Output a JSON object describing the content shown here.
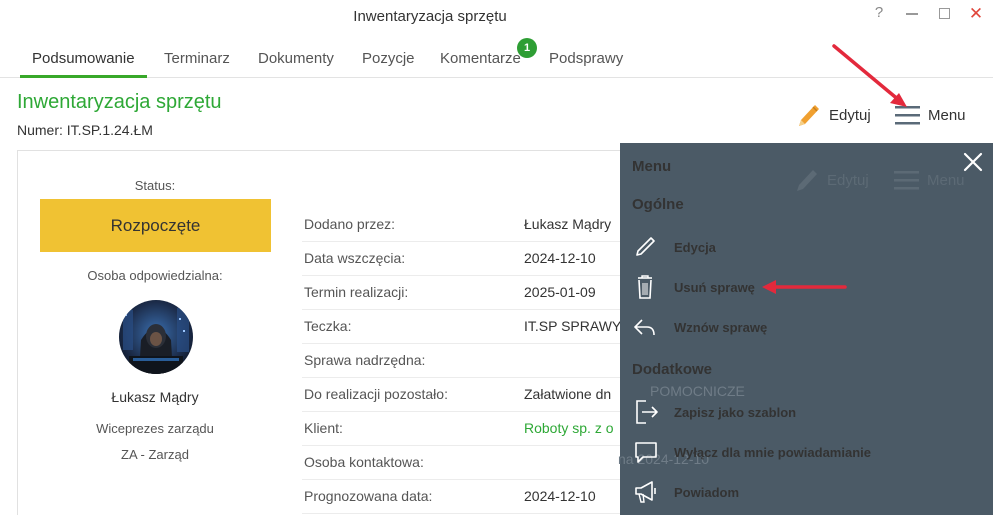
{
  "window": {
    "title": "Inwentaryzacja sprzętu",
    "help": "?",
    "close": "✕"
  },
  "tabs": [
    {
      "label": "Podsumowanie",
      "active": true
    },
    {
      "label": "Terminarz"
    },
    {
      "label": "Dokumenty"
    },
    {
      "label": "Pozycje"
    },
    {
      "label": "Komentarze",
      "badge": "1"
    },
    {
      "label": "Podsprawy"
    }
  ],
  "header": {
    "title": "Inwentaryzacja sprzętu",
    "number": "Numer: IT.SP.1.24.ŁM",
    "edit_label": "Edytuj",
    "menu_label": "Menu"
  },
  "status": {
    "label": "Status:",
    "value": "Rozpoczęte",
    "color": "#f0c233"
  },
  "responsible": {
    "label": "Osoba odpowiedzialna:",
    "name": "Łukasz Mądry",
    "role": "Wiceprezes zarządu",
    "department": "ZA - Zarząd"
  },
  "details": [
    {
      "key": "Dodano przez:",
      "value": "Łukasz Mądry"
    },
    {
      "key": "Data wszczęcia:",
      "value": "2024-12-10"
    },
    {
      "key": "Termin realizacji:",
      "value": "2025-01-09"
    },
    {
      "key": "Teczka:",
      "value": "IT.SP SPRAWY"
    },
    {
      "key": "Sprawa nadrzędna:",
      "value": ""
    },
    {
      "key": "Do realizacji pozostało:",
      "value": "Załatwione dn"
    },
    {
      "key": "Klient:",
      "value": "Roboty sp. z o"
    },
    {
      "key": "Osoba kontaktowa:",
      "value": ""
    },
    {
      "key": "Prognozowana data:",
      "value": "2024-12-10"
    }
  ],
  "background_text": {
    "pomocnicze": "POMOCNICZE",
    "date_fragment": "na 2024-12-10"
  },
  "menu": {
    "title": "Menu",
    "sections": [
      {
        "title": "Ogólne",
        "items": [
          {
            "label": "Edycja",
            "icon": "pencil-icon"
          },
          {
            "label": "Usuń sprawę",
            "icon": "trash-icon"
          },
          {
            "label": "Wznów sprawę",
            "icon": "reply-icon"
          }
        ]
      },
      {
        "title": "Dodatkowe",
        "items": [
          {
            "label": "Zapisz jako szablon",
            "icon": "export-icon"
          },
          {
            "label": "Wyłącz dla mnie powiadamianie",
            "icon": "chat-bubble-icon"
          },
          {
            "label": "Powiadom",
            "icon": "megaphone-icon"
          }
        ]
      }
    ]
  },
  "colors": {
    "accent_green": "#2ea836",
    "menu_bg": "#4b5a66",
    "arrow_red": "#e3293c",
    "pencil_orange": "#f0a030"
  }
}
